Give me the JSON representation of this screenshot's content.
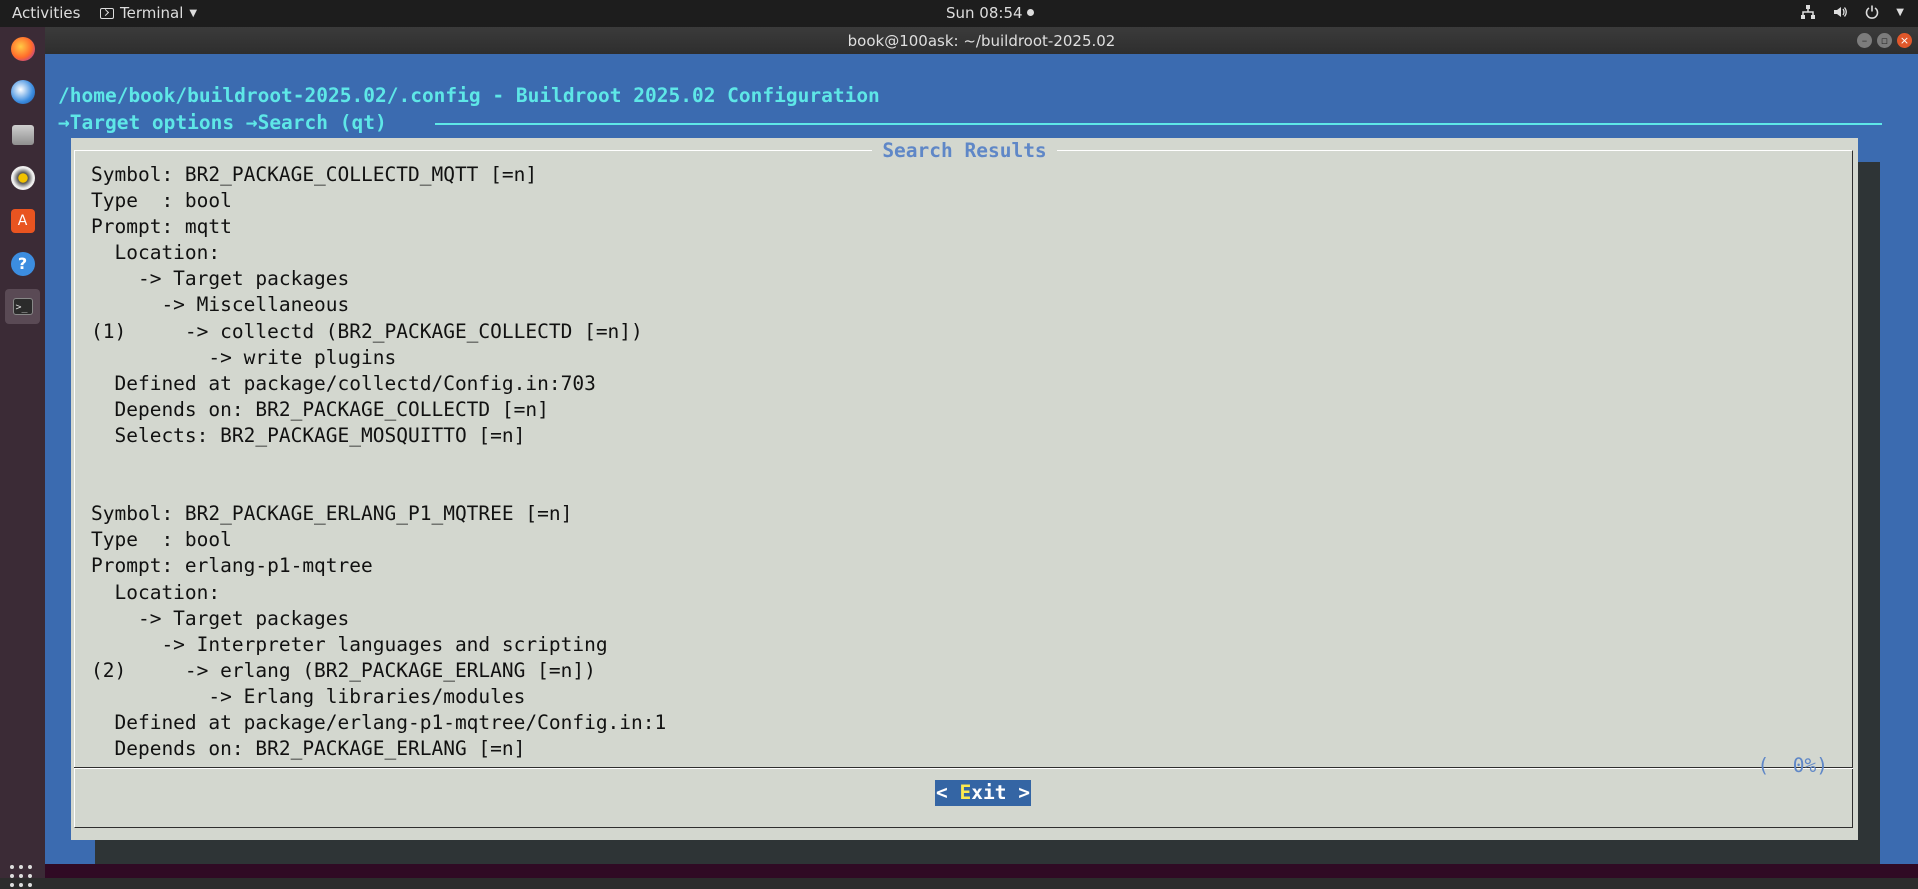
{
  "topbar": {
    "activities": "Activities",
    "app_name": "Terminal",
    "clock": "Sun 08:54"
  },
  "dock": {
    "items": [
      "firefox-icon",
      "thunderbird-icon",
      "files-icon",
      "rhythmbox-icon",
      "software-icon",
      "help-icon",
      "terminal-icon"
    ]
  },
  "window": {
    "title": "book@100ask: ~/buildroot-2025.02"
  },
  "terminal": {
    "config_path": "/home/book/buildroot-2025.02/.config - Buildroot 2025.02 Configuration",
    "breadcrumb": "→Target options →Search (qt)",
    "dialog_title": "Search Results",
    "results_lines": [
      "Symbol: BR2_PACKAGE_COLLECTD_MQTT [=n]",
      "Type  : bool",
      "Prompt: mqtt",
      "  Location:",
      "    -> Target packages",
      "      -> Miscellaneous",
      "(1)     -> collectd (BR2_PACKAGE_COLLECTD [=n])",
      "          -> write plugins",
      "  Defined at package/collectd/Config.in:703",
      "  Depends on: BR2_PACKAGE_COLLECTD [=n]",
      "  Selects: BR2_PACKAGE_MOSQUITTO [=n]",
      "",
      "",
      "Symbol: BR2_PACKAGE_ERLANG_P1_MQTREE [=n]",
      "Type  : bool",
      "Prompt: erlang-p1-mqtree",
      "  Location:",
      "    -> Target packages",
      "      -> Interpreter languages and scripting",
      "(2)     -> erlang (BR2_PACKAGE_ERLANG [=n])",
      "          -> Erlang libraries/modules",
      "  Defined at package/erlang-p1-mqtree/Config.in:1",
      "  Depends on: BR2_PACKAGE_ERLANG [=n]"
    ],
    "scroll_indicator": "(  0%)",
    "exit_button": {
      "prefix": "< ",
      "hotkey": "E",
      "rest": "xit >"
    }
  },
  "colors": {
    "terminal_bg": "#3b6bb0",
    "dialog_bg": "#d3d7cf",
    "header_text": "#5ee7e7",
    "title_text": "#5f87c7",
    "button_bg": "#3465a4",
    "hotkey": "#fce94f"
  }
}
